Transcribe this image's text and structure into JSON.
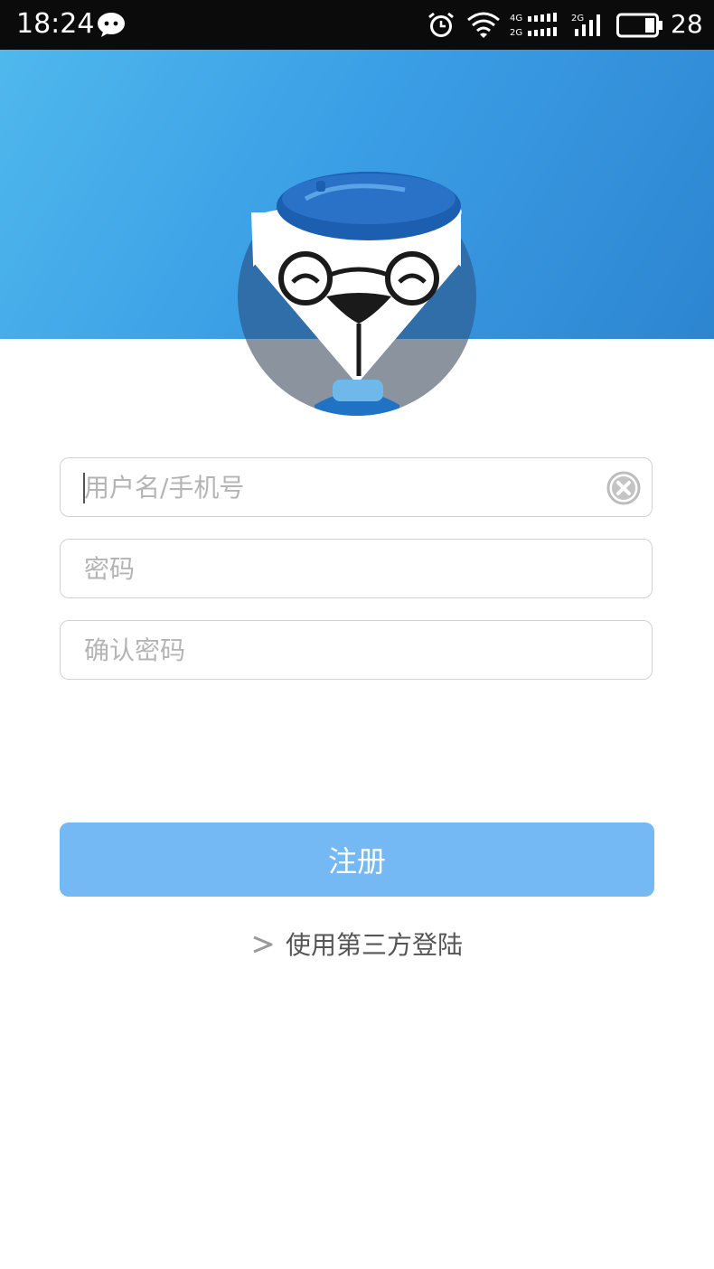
{
  "status_bar": {
    "time": "18:24",
    "battery_level": "28",
    "icons": [
      "wechat-icon",
      "alarm-icon",
      "wifi-icon",
      "signal-4g-2g-icon",
      "signal-2g-icon",
      "battery-icon"
    ]
  },
  "header": {
    "background_gradient": [
      "#4fb8ec",
      "#2d85d0"
    ],
    "avatar_icon": "mascot-dog-beret-glasses-icon"
  },
  "form": {
    "username": {
      "placeholder": "用户名/手机号",
      "value": ""
    },
    "password": {
      "placeholder": "密码",
      "value": ""
    },
    "confirm_password": {
      "placeholder": "确认密码",
      "value": ""
    }
  },
  "register_button": {
    "label": "注册",
    "color": "#74b9f3"
  },
  "third_party_login": {
    "label": "使用第三方登陆"
  }
}
